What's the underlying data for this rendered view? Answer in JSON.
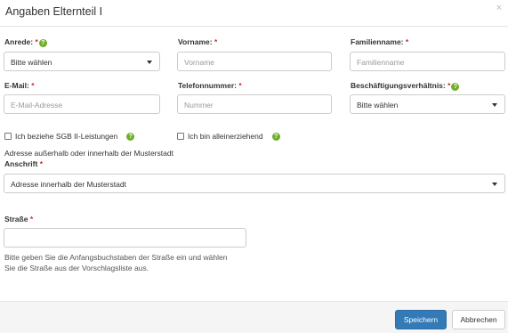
{
  "dialog": {
    "title": "Angaben Elternteil I",
    "close_symbol": "×"
  },
  "form": {
    "anrede": {
      "label": "Anrede:",
      "required": "*",
      "help": "?",
      "value": "Bitte wählen"
    },
    "vorname": {
      "label": "Vorname:",
      "required": "*",
      "placeholder": "Vorname"
    },
    "familienname": {
      "label": "Familienname:",
      "required": "*",
      "placeholder": "Familienname"
    },
    "email": {
      "label": "E-Mail:",
      "required": "*",
      "placeholder": "E-Mail-Adresse"
    },
    "telefon": {
      "label": "Telefonnummer:",
      "required": "*",
      "placeholder": "Nummer"
    },
    "beschaeftigung": {
      "label": "Beschäftigungsverhältnis:",
      "required": "*",
      "help": "?",
      "value": "Bitte wählen"
    },
    "sgb": {
      "label": "Ich beziehe SGB II-Leistungen",
      "help": "?",
      "checked": false
    },
    "alleinerziehend": {
      "label": "Ich bin alleinerziehend",
      "help": "?",
      "checked": false
    },
    "address_note": "Adresse außerhalb oder innerhalb der Musterstadt",
    "anschrift": {
      "label": "Anschrift",
      "required": "*",
      "value": "Adresse innerhalb der Musterstadt"
    },
    "strasse": {
      "label": "Straße",
      "required": "*",
      "placeholder": "",
      "hint_line1": "Bitte geben Sie die Anfangsbuchstaben der Straße ein und wählen",
      "hint_line2": "Sie die Straße aus der Vorschlagsliste aus."
    }
  },
  "footer": {
    "save_label": "Speichern",
    "cancel_label": "Abbrechen"
  },
  "colors": {
    "primary": "#337ab7",
    "required": "#c9302c",
    "help": "#6fae2a"
  },
  "icons": [
    "close-icon",
    "help-icon",
    "caret-down-icon"
  ]
}
